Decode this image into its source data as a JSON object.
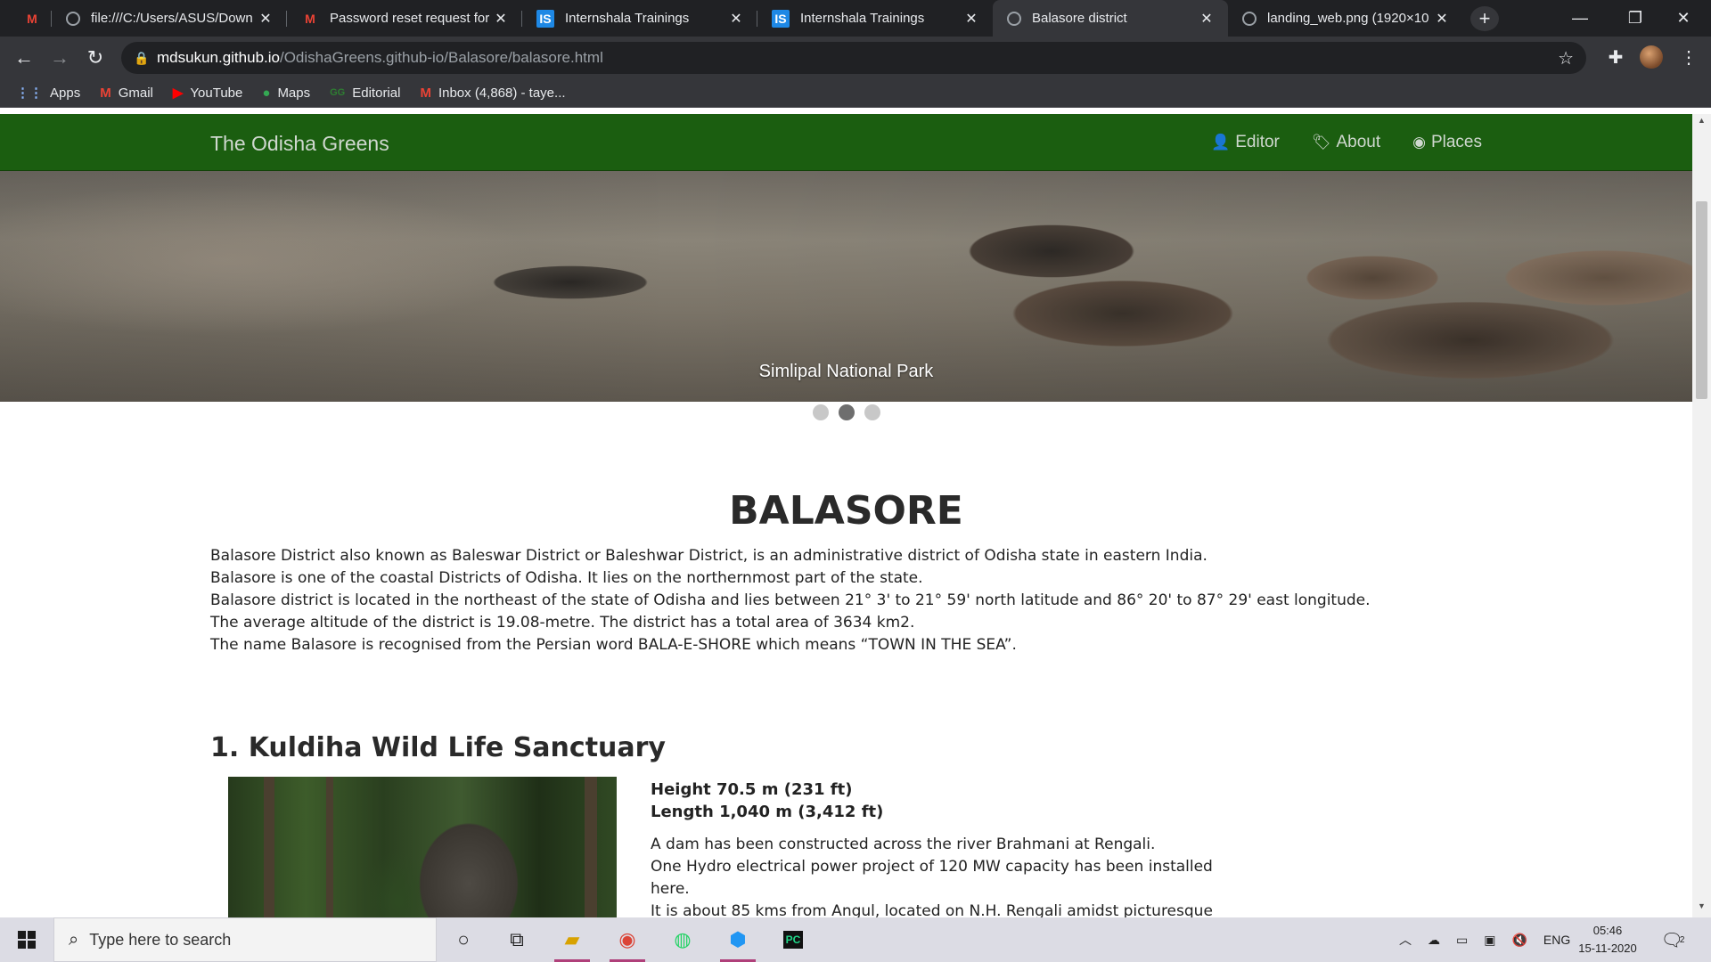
{
  "browser": {
    "tabs": [
      {
        "title": "",
        "icon": "gmail-icon"
      },
      {
        "title": "file:///C:/Users/ASUS/Down",
        "icon": "globe-icon"
      },
      {
        "title": "Password reset request for",
        "icon": "gmail-icon"
      },
      {
        "title": "Internshala Trainings",
        "icon": "internshala-icon"
      },
      {
        "title": "Internshala Trainings",
        "icon": "internshala-icon"
      },
      {
        "title": "Balasore district",
        "icon": "globe-icon",
        "active": true
      },
      {
        "title": "landing_web.png (1920×10",
        "icon": "globe-icon"
      }
    ],
    "url_host": "mdsukun.github.io",
    "url_path": "/OdishaGreens.github-io/Balasore/balasore.html",
    "bookmarks": [
      {
        "label": "Apps",
        "icon": "apps-grid-icon"
      },
      {
        "label": "Gmail",
        "icon": "gmail-icon"
      },
      {
        "label": "YouTube",
        "icon": "youtube-icon"
      },
      {
        "label": "Maps",
        "icon": "maps-pin-icon"
      },
      {
        "label": "Editorial",
        "icon": "editorial-icon"
      },
      {
        "label": "Inbox (4,868) - taye...",
        "icon": "gmail-icon"
      }
    ]
  },
  "site": {
    "brand": "The Odisha Greens",
    "nav": [
      {
        "label": "Editor",
        "icon": "user-icon"
      },
      {
        "label": "About",
        "icon": "tags-icon"
      },
      {
        "label": "Places",
        "icon": "globe-icon"
      }
    ],
    "carousel": {
      "caption": "Simlipal National Park",
      "slide_count": 3,
      "active_index": 1
    },
    "title": "BALASORE",
    "intro": [
      "Balasore District also known as Baleswar District or Baleshwar District, is an administrative district of Odisha state in eastern India.",
      "Balasore is one of the coastal Districts of Odisha. It lies on the northernmost part of the state.",
      "Balasore district is located in the northeast of the state of Odisha and lies between 21° 3' to 21° 59' north latitude and 86° 20' to 87° 29' east longitude.",
      "The average altitude of the district is 19.08-metre. The district has a total area of 3634 km2.",
      "The name Balasore is recognised from the Persian word BALA-E-SHORE which means “TOWN IN THE SEA”."
    ],
    "section1": {
      "title": "1. Kuldiha Wild Life Sanctuary",
      "height": "Height 70.5 m (231 ft)",
      "length": "Length 1,040 m (3,412 ft)",
      "desc": [
        "A dam has been constructed across the river Brahmani at Rengali.",
        "One Hydro electrical power project of 120 MW capacity has been installed",
        "here.",
        "It is about 85 kms from Angul, located on N.H. Rengali amidst picturesque"
      ]
    }
  },
  "taskbar": {
    "search_placeholder": "Type here to search",
    "language": "ENG",
    "time": "05:46",
    "date": "15-11-2020",
    "notification_count": "2"
  }
}
